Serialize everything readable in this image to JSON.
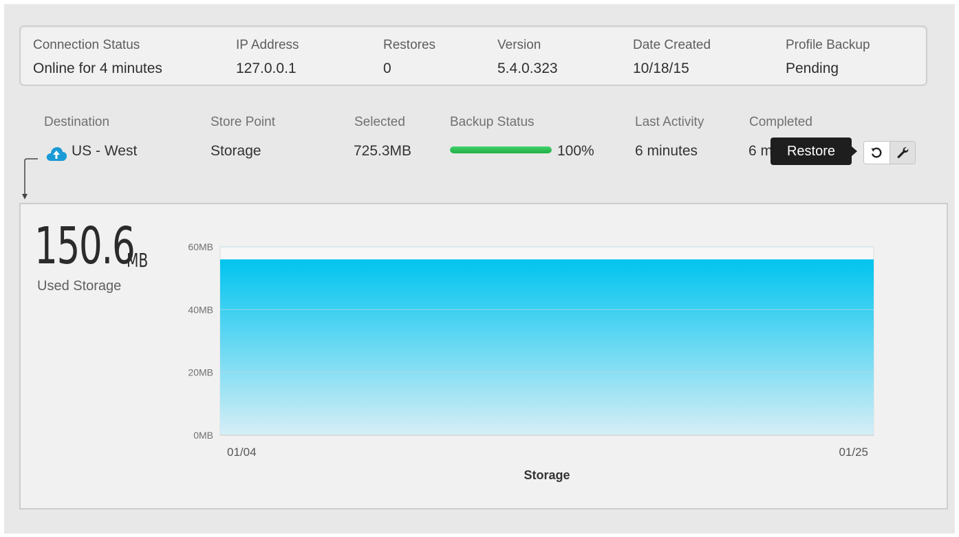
{
  "summary": {
    "columns": [
      {
        "label": "Connection Status",
        "value": "Online for 4 minutes"
      },
      {
        "label": "IP Address",
        "value": "127.0.0.1"
      },
      {
        "label": "Restores",
        "value": "0"
      },
      {
        "label": "Version",
        "value": "5.4.0.323"
      },
      {
        "label": "Date Created",
        "value": "10/18/15"
      },
      {
        "label": "Profile Backup",
        "value": "Pending"
      }
    ]
  },
  "destinations": {
    "headers": {
      "destination": "Destination",
      "store_point": "Store Point",
      "selected": "Selected",
      "backup_status": "Backup Status",
      "last_activity": "Last Activity",
      "completed": "Completed"
    },
    "row": {
      "destination": "US - West",
      "store_point": "Storage",
      "selected": "725.3MB",
      "backup_progress": 100,
      "backup_percent_text": "100%",
      "last_activity": "6 minutes",
      "completed": "6 mi",
      "icon": "cloud-upload-icon"
    },
    "actions": {
      "restore_tooltip": "Restore",
      "restore_icon": "refresh-icon",
      "settings_icon": "wrench-icon"
    }
  },
  "storage": {
    "used_value": "150.6",
    "used_unit": "MB",
    "used_label": "Used Storage"
  },
  "colors": {
    "progress": "#2ec955",
    "area_top": "#00c4ef",
    "area_bottom": "#d6eef6",
    "cloud": "#1a9ad6",
    "tooltip_bg": "#1e1e1e"
  },
  "chart_data": {
    "type": "area",
    "x": [
      "01/04",
      "01/25"
    ],
    "series": [
      {
        "values": [
          56,
          56
        ]
      }
    ],
    "y_ticks": [
      "0MB",
      "20MB",
      "40MB",
      "60MB"
    ],
    "ylim": [
      0,
      60
    ],
    "xlabel": "Storage",
    "ylabel": "",
    "grid": true
  }
}
